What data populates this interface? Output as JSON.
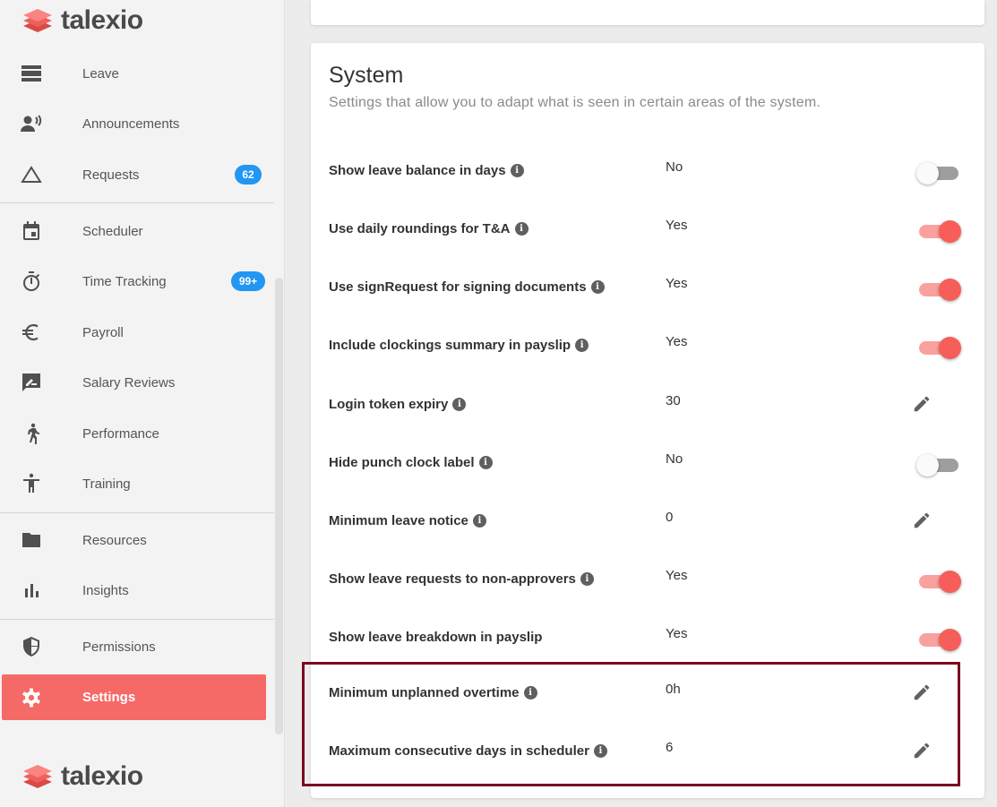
{
  "app": {
    "logo_text": "talexio"
  },
  "sidebar": {
    "items": [
      {
        "label": "Leave",
        "icon": "leave-icon"
      },
      {
        "label": "Announcements",
        "icon": "announcements-icon"
      },
      {
        "label": "Requests",
        "icon": "requests-icon",
        "badge": "62"
      },
      {
        "label": "Scheduler",
        "icon": "calendar-icon"
      },
      {
        "label": "Time Tracking",
        "icon": "stopwatch-icon",
        "badge": "99+"
      },
      {
        "label": "Payroll",
        "icon": "euro-icon"
      },
      {
        "label": "Salary Reviews",
        "icon": "salary-review-icon"
      },
      {
        "label": "Performance",
        "icon": "running-person-icon"
      },
      {
        "label": "Training",
        "icon": "accessibility-person-icon"
      },
      {
        "label": "Resources",
        "icon": "folder-icon"
      },
      {
        "label": "Insights",
        "icon": "bar-chart-icon"
      },
      {
        "label": "Permissions",
        "icon": "shield-icon"
      },
      {
        "label": "Settings",
        "icon": "gear-icon",
        "active": true
      }
    ],
    "badge_color": "#2196f3",
    "active_color": "#f56a67"
  },
  "system": {
    "title": "System",
    "subtitle": "Settings that allow you to adapt what is seen in certain areas of the system.",
    "settings": [
      {
        "name": "Show leave balance in days",
        "value": "No",
        "control": "toggle",
        "on": false
      },
      {
        "name": "Use daily roundings for T&A",
        "value": "Yes",
        "control": "toggle",
        "on": true
      },
      {
        "name": "Use signRequest for signing documents",
        "value": "Yes",
        "control": "toggle",
        "on": true
      },
      {
        "name": "Include clockings summary in payslip",
        "value": "Yes",
        "control": "toggle",
        "on": true
      },
      {
        "name": "Login token expiry",
        "value": "30",
        "control": "edit"
      },
      {
        "name": "Hide punch clock label",
        "value": "No",
        "control": "toggle",
        "on": false
      },
      {
        "name": "Minimum leave notice",
        "value": "0",
        "control": "edit"
      },
      {
        "name": "Show leave requests to non-approvers",
        "value": "Yes",
        "control": "toggle",
        "on": true
      },
      {
        "name": "Show leave breakdown in payslip",
        "value": "Yes",
        "control": "toggle",
        "on": true
      },
      {
        "name": "Minimum unplanned overtime",
        "value": "0h",
        "control": "edit"
      },
      {
        "name": "Maximum consecutive days in scheduler",
        "value": "6",
        "control": "edit"
      }
    ]
  },
  "colors": {
    "toggle_on": "#f75e5a",
    "highlight_border": "#7a0a1e"
  }
}
